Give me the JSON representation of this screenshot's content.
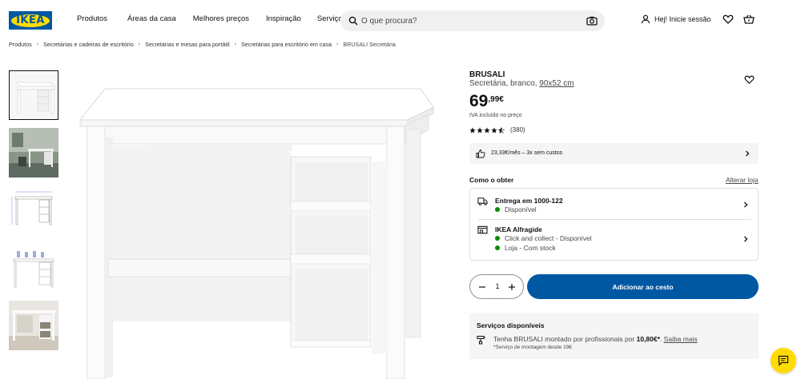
{
  "header": {
    "logo_text": "IKEA",
    "nav": [
      "Produtos",
      "Áreas da casa",
      "Melhores preços",
      "Inspiração",
      "Serviços"
    ],
    "search_placeholder": "O que procura?",
    "login_label": "Hej! Inicie sessão"
  },
  "breadcrumb": {
    "items": [
      "Produtos",
      "Secretárias e cadeiras de escritório",
      "Secretárias e mesas para portátil",
      "Secretárias para escritório em casa",
      "BRUSALI Secretária"
    ]
  },
  "product": {
    "name": "BRUSALI",
    "description": "Secretária, branco,",
    "size": "90x52 cm",
    "price_int": "69",
    "price_dec": ",99€",
    "vat_note": "IVA incluído no preço",
    "rating_value": 4.5,
    "rating_count": "(380)",
    "finance_text": "23,33€/mês – 3x sem custos"
  },
  "availability": {
    "heading": "Como o obter",
    "change_store": "Alterar loja",
    "delivery_title": "Entrega em 1000-122",
    "delivery_status": "Disponível",
    "store_title": "IKEA Alfragide",
    "store_click": "Click and collect - Disponível",
    "store_stock": "Loja - Com stock"
  },
  "cart": {
    "quantity": "1",
    "add_label": "Adicionar ao cesto"
  },
  "services": {
    "title": "Serviços disponíveis",
    "line_prefix": "Tenha BRUSALI montado por profissionais por ",
    "line_price": "10,80€*",
    "line_dot": ".",
    "more": "Saiba mais",
    "note": "*Serviço de montagem desde 19€"
  },
  "colors": {
    "brand_blue": "#0058a3",
    "brand_yellow": "#ffdb00",
    "stock_green": "#0a8a00"
  }
}
